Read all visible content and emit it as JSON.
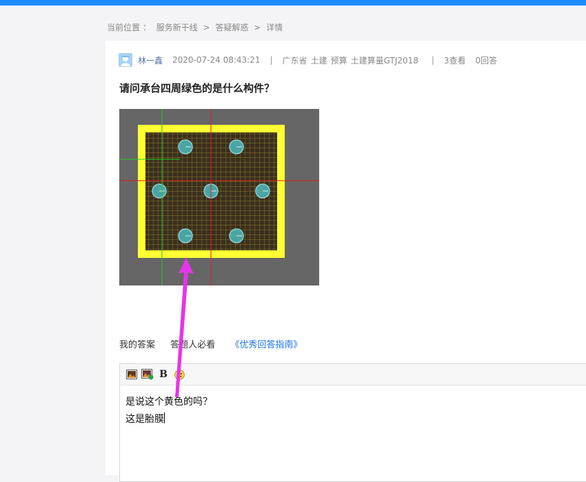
{
  "breadcrumb": {
    "label": "当前位置 ：",
    "items": [
      "服务新干线",
      "答疑解惑",
      "详情"
    ],
    "separator": ">"
  },
  "question": {
    "user": "林一鑫",
    "datetime": "2020-07-24 08:43:21",
    "region": "广东省",
    "tags": [
      "土建",
      "预算",
      "土建算量GTJ2018"
    ],
    "views": "3查看",
    "answers": "0回答",
    "title": "请问承台四周绿色的是什么构件？"
  },
  "answer": {
    "my_answer_label": "我的答案",
    "must_read_label": "答题人必看",
    "guide_link": "《优秀回答指南》"
  },
  "editor": {
    "lines": [
      "是说这个黄色的吗？",
      "这是胎膜"
    ],
    "toolbar": {
      "bold_label": "B"
    }
  },
  "colors": {
    "accent": "#1a8cff",
    "link": "#1a73e8",
    "annotation_arrow": "#e535e8",
    "cad_border": "#ffff33",
    "cad_background": "#666666"
  }
}
